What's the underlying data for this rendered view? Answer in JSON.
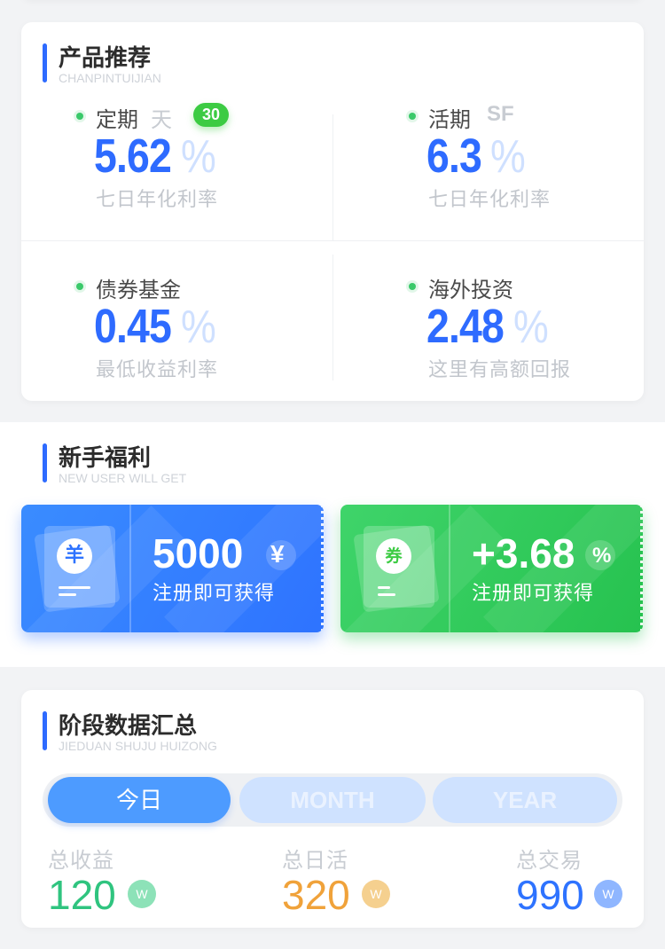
{
  "products": {
    "title": "产品推荐",
    "subtitle": "CHANPINTUIJIAN",
    "items": [
      {
        "name": "定期",
        "tag": "天",
        "badge": "30",
        "rate": "5.62",
        "unit": "%",
        "desc": "七日年化利率"
      },
      {
        "name": "活期",
        "tag": "SF",
        "badge": "",
        "rate": "6.3",
        "unit": "%",
        "desc": "七日年化利率"
      },
      {
        "name": "债券基金",
        "tag": "",
        "badge": "",
        "rate": "0.45",
        "unit": "%",
        "desc": "最低收益利率"
      },
      {
        "name": "海外投资",
        "tag": "",
        "badge": "",
        "rate": "2.48",
        "unit": "%",
        "desc": "这里有高额回报"
      }
    ]
  },
  "welfare": {
    "title": "新手福利",
    "subtitle": "NEW USER WILL GET",
    "coupons": [
      {
        "icon_char": "羊",
        "amount": "5000",
        "unit": "¥",
        "desc": "注册即可获得",
        "color": "#2e73ff"
      },
      {
        "icon_char": "券",
        "amount": "+3.68",
        "unit": "%",
        "desc": "注册即可获得",
        "color": "#26c24f"
      }
    ]
  },
  "stats": {
    "title": "阶段数据汇总",
    "subtitle": "JIEDUAN SHUJU HUIZONG",
    "tabs": [
      "今日",
      "MONTH",
      "YEAR"
    ],
    "active_tab": "今日",
    "items": [
      {
        "label": "总收益",
        "value": "120",
        "unit": "W",
        "color": "#2fc47f",
        "unit_bg": "#8de2b8"
      },
      {
        "label": "总日活",
        "value": "320",
        "unit": "W",
        "color": "#f0a23a",
        "unit_bg": "#f5d08f"
      },
      {
        "label": "总交易",
        "value": "990",
        "unit": "W",
        "color": "#2e73ff",
        "unit_bg": "#8fb6ff"
      }
    ]
  }
}
